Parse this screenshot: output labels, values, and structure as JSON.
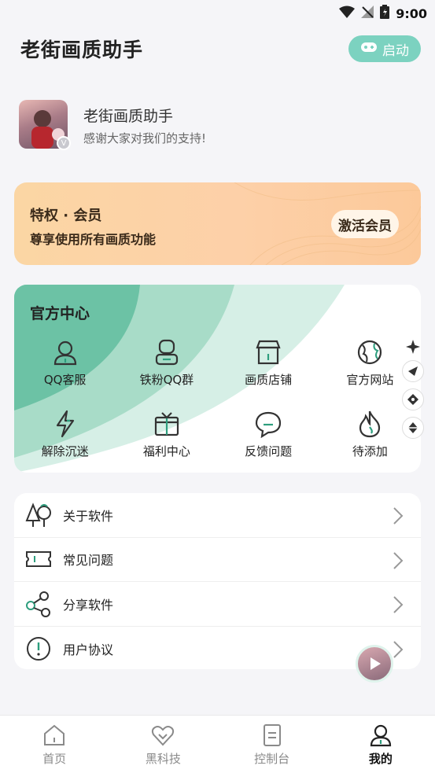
{
  "status_bar": {
    "time": "9:00"
  },
  "header": {
    "title": "老街画质助手",
    "launch_label": "启动"
  },
  "profile": {
    "name": "老街画质助手",
    "subtitle": "感谢大家对我们的支持!"
  },
  "vip": {
    "title": "特权 · 会员",
    "subtitle": "尊享使用所有画质功能",
    "button": "激活会员"
  },
  "official_center": {
    "title": "官方中心",
    "items": [
      {
        "label": "QQ客服",
        "icon": "user-icon"
      },
      {
        "label": "铁粉QQ群",
        "icon": "group-icon"
      },
      {
        "label": "画质店铺",
        "icon": "shop-icon"
      },
      {
        "label": "官方网站",
        "icon": "globe-icon"
      },
      {
        "label": "解除沉迷",
        "icon": "lightning-icon"
      },
      {
        "label": "福利中心",
        "icon": "gift-icon"
      },
      {
        "label": "反馈问题",
        "icon": "chat-icon"
      },
      {
        "label": "待添加",
        "icon": "flame-icon"
      }
    ]
  },
  "menu": {
    "items": [
      {
        "label": "关于软件",
        "icon": "trees-icon"
      },
      {
        "label": "常见问题",
        "icon": "ticket-icon"
      },
      {
        "label": "分享软件",
        "icon": "share-icon"
      },
      {
        "label": "用户协议",
        "icon": "alert-icon"
      }
    ]
  },
  "tabbar": {
    "tabs": [
      {
        "label": "首页",
        "icon": "home-icon"
      },
      {
        "label": "黑科技",
        "icon": "heart-icon"
      },
      {
        "label": "控制台",
        "icon": "document-icon"
      },
      {
        "label": "我的",
        "icon": "person-icon",
        "active": true
      }
    ]
  },
  "colors": {
    "accent": "#2e9e7e",
    "launch_bg": "#7cd2c0",
    "vip_bg": "#fcd3a4"
  }
}
